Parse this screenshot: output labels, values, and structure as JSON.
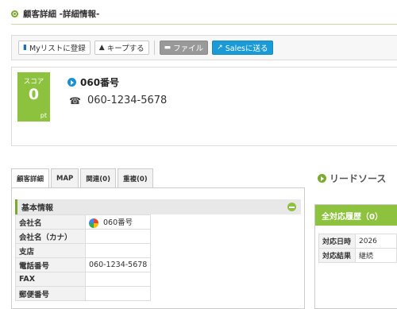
{
  "header": {
    "title": "顧客詳細 -詳細情報-"
  },
  "toolbar": {
    "mylist_label": "Myリストに登録",
    "keep_label": "キープする",
    "file_label": "ファイル",
    "sales_label": "Salesに送る"
  },
  "customer": {
    "score_label": "スコア",
    "score_value": "0",
    "score_unit": "pt",
    "name": "060番号",
    "phone": "060-1234-5678"
  },
  "tabs": [
    "顧客詳細",
    "MAP",
    "関連(0)",
    "重複(0)"
  ],
  "basic_info": {
    "title": "基本情報",
    "rows": [
      {
        "label": "会社名",
        "value": "060番号"
      },
      {
        "label": "会社名（カナ）",
        "value": ""
      },
      {
        "label": "支店",
        "value": ""
      },
      {
        "label": "電話番号",
        "value": "060-1234-5678"
      },
      {
        "label": "FAX",
        "value": ""
      },
      {
        "label": "郵便番号",
        "value": ""
      }
    ]
  },
  "lead_source": {
    "title": "リードソース"
  },
  "history": {
    "title": "全対応履歴（0）",
    "rows": [
      {
        "label": "対応日時",
        "value": "2026"
      },
      {
        "label": "対応結果",
        "value": "継続"
      }
    ]
  },
  "colors": {
    "accent_green": "#8dc23f",
    "accent_blue": "#1a9ad6"
  }
}
